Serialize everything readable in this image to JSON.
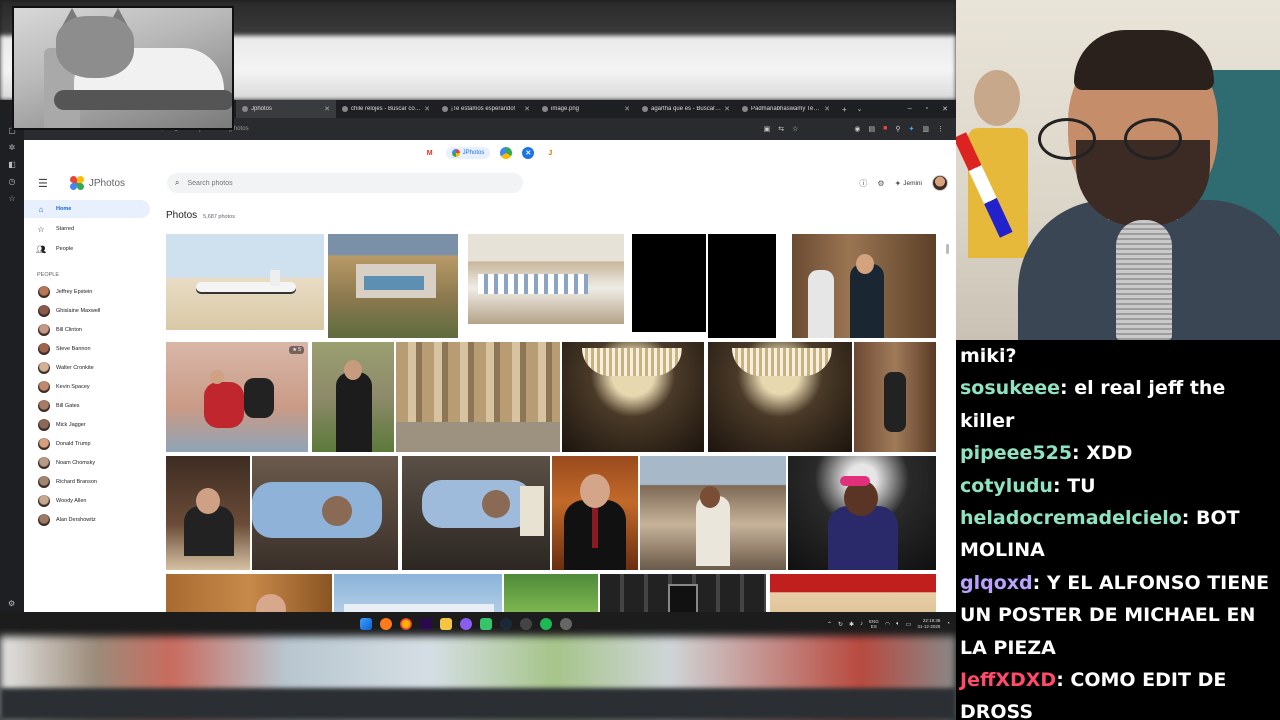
{
  "browser": {
    "tabs": [
      {
        "label": "Jphotos",
        "active": true
      },
      {
        "label": "chile relojes - Buscar con G",
        "active": false
      },
      {
        "label": "¡Te estamos esperando!",
        "active": false
      },
      {
        "label": "image.png",
        "active": false
      },
      {
        "label": "agartha que es - Buscar co",
        "active": false
      },
      {
        "label": "Padmanabhaswamy Templ",
        "active": false
      }
    ],
    "url": "www.jmail.world/jphotos"
  },
  "app": {
    "name": "JPhotos",
    "search_placeholder": "Search photos",
    "jemini_label": "Jemini",
    "nav": [
      {
        "label": "Home",
        "icon": "home-icon",
        "active": true
      },
      {
        "label": "Starred",
        "icon": "star-icon",
        "active": false
      },
      {
        "label": "People",
        "icon": "people-icon",
        "active": false
      }
    ],
    "people_heading": "PEOPLE",
    "people": [
      "Jeffrey Epstein",
      "Ghislaine Maxwell",
      "Bill Clinton",
      "Steve Bannon",
      "Walter Cronkite",
      "Kevin Spacey",
      "Bill Gates",
      "Mick Jagger",
      "Donald Trump",
      "Noam Chomsky",
      "Richard Branson",
      "Woody Allen",
      "Alan Dershowitz"
    ],
    "photos_title": "Photos",
    "photos_count": "5,687 photos",
    "star_badge": "★ 5"
  },
  "taskbar": {
    "lang": [
      "ENG",
      "ES"
    ],
    "time": "22:19:38",
    "date": "31-12-2025"
  },
  "chat": [
    {
      "user": "",
      "color": "#ffffff",
      "text": "miki?"
    },
    {
      "user": "sosukeee",
      "color": "#8fe3c2",
      "text": "el real jeff the killer"
    },
    {
      "user": "pipeee525",
      "color": "#8fe3c2",
      "text": "XDD"
    },
    {
      "user": "cotyludu",
      "color": "#8fe3c2",
      "text": "TU"
    },
    {
      "user": "heladocremadelcielo",
      "color": "#8fe3c2",
      "text": "BOT MOLINA"
    },
    {
      "user": "glqoxd",
      "color": "#b9a3ff",
      "text": "Y EL ALFONSO TIENE UN POSTER DE MICHAEL EN LA PIEZA"
    },
    {
      "user": "JeffXDXD",
      "color": "#ff4a6b",
      "text": "COMO EDIT DE DROSS"
    }
  ]
}
